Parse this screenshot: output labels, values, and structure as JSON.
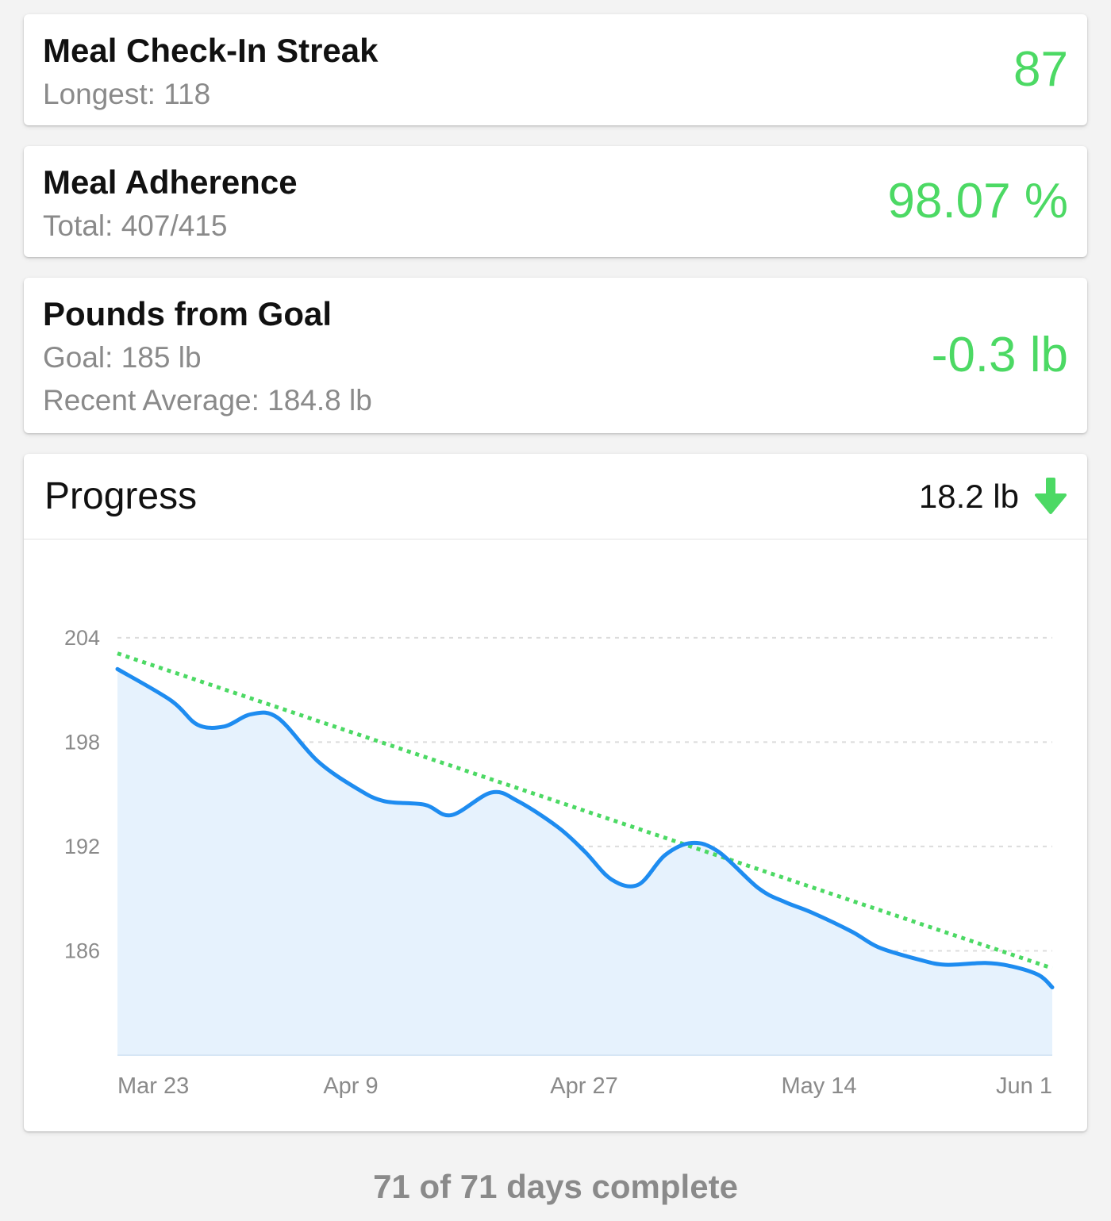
{
  "stats": {
    "streak": {
      "title": "Meal Check-In Streak",
      "sub1": "Longest: 118",
      "value": "87"
    },
    "adherence": {
      "title": "Meal Adherence",
      "sub1": "Total: 407/415",
      "value": "98.07 %"
    },
    "pounds": {
      "title": "Pounds from Goal",
      "sub1": "Goal: 185 lb",
      "sub2": "Recent Average: 184.8 lb",
      "value": "-0.3 lb"
    }
  },
  "progress": {
    "title": "Progress",
    "total_change": "18.2 lb",
    "trend_icon": "arrow-down-icon"
  },
  "footer": {
    "text": "71 of 71 days complete"
  },
  "colors": {
    "accent_green": "#4cd964",
    "line_blue": "#1e8cf0",
    "area_fill": "#e6f2fd",
    "muted_text": "#8a8a8a"
  },
  "chart_data": {
    "type": "area",
    "title": "",
    "xlabel": "",
    "ylabel": "",
    "ylim": [
      180,
      206
    ],
    "y_ticks": [
      204,
      198,
      192,
      186
    ],
    "x_tick_labels": [
      "Mar 23",
      "Apr 9",
      "Apr 27",
      "May 14",
      "Jun 1"
    ],
    "grid": true,
    "series": [
      {
        "type": "line",
        "x": [
          "Mar 23",
          "Mar 27",
          "Mar 29",
          "Mar 31",
          "Apr 2",
          "Apr 4",
          "Apr 7",
          "Apr 10",
          "Apr 12",
          "Apr 15",
          "Apr 17",
          "Apr 20",
          "Apr 22",
          "Apr 25",
          "Apr 27",
          "Apr 29",
          "May 1",
          "May 3",
          "May 5",
          "May 7",
          "May 10",
          "May 12",
          "May 14",
          "May 17",
          "May 19",
          "May 22",
          "May 24",
          "May 27",
          "May 29",
          "May 31",
          "Jun 1"
        ],
        "y": [
          202.2,
          200.4,
          199.0,
          198.9,
          199.6,
          199.4,
          196.9,
          195.3,
          194.6,
          194.4,
          193.8,
          195.1,
          194.6,
          193.1,
          191.7,
          190.1,
          189.8,
          191.5,
          192.2,
          191.7,
          189.6,
          188.8,
          188.2,
          187.1,
          186.2,
          185.5,
          185.2,
          185.3,
          185.1,
          184.6,
          183.9
        ]
      },
      {
        "type": "trend",
        "x": [
          "Mar 23",
          "Jun 1"
        ],
        "y": [
          203.1,
          185.0
        ]
      }
    ]
  }
}
